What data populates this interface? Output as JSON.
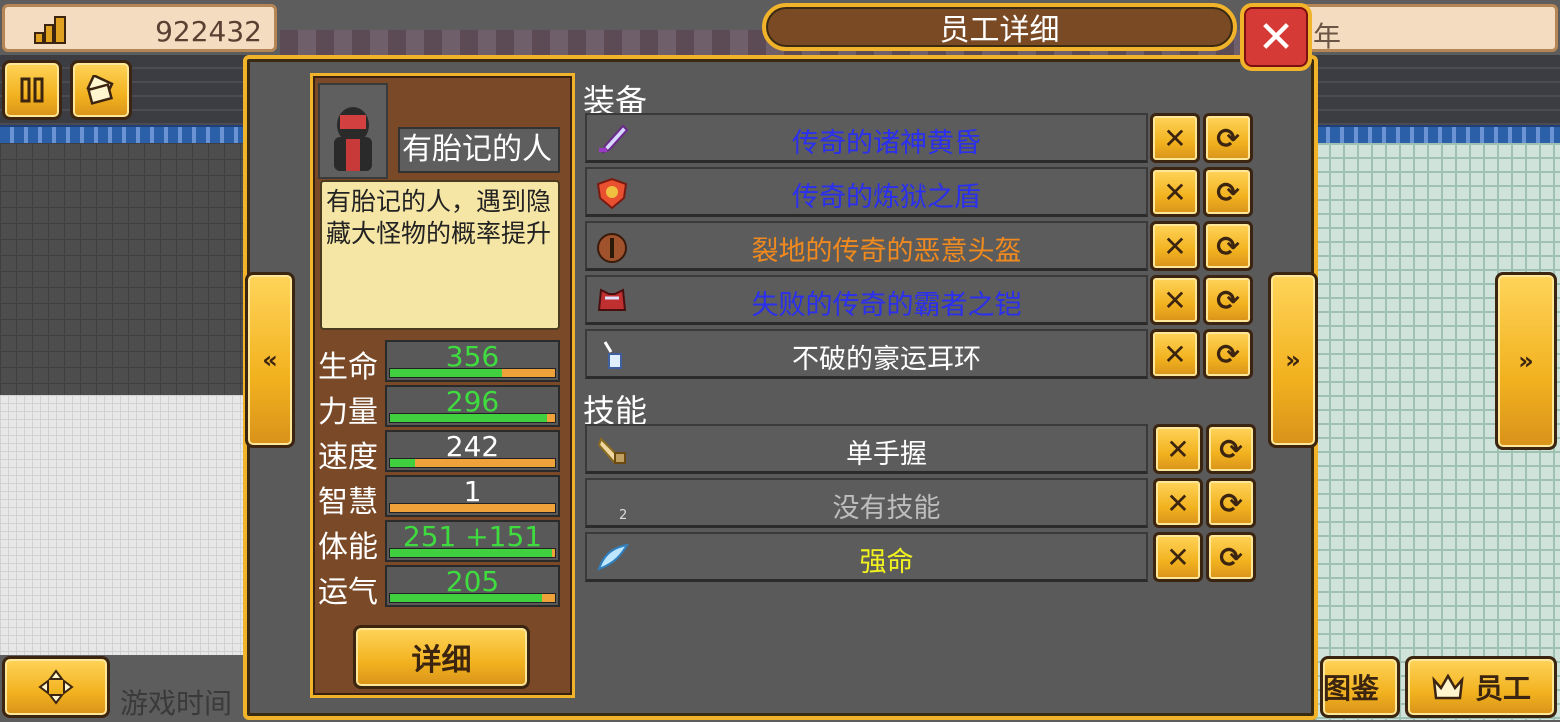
{
  "hud": {
    "money": "922432",
    "top_right_partial": "年",
    "game_time_label": "游戏时间",
    "book_label": "图鉴",
    "staff_label": "员工"
  },
  "dialog": {
    "title": "员工详细",
    "close_glyph": "✕",
    "prev_glyph": "«",
    "next_glyph": "»"
  },
  "character": {
    "name": "有胎记的人",
    "description": "有胎记的人，遇到隐藏大怪物的概率提升",
    "detail_label": "详细",
    "stats": [
      {
        "label": "生命",
        "value": "356",
        "color": "#3fdc3f",
        "fill": 0.68
      },
      {
        "label": "力量",
        "value": "296",
        "color": "#3fdc3f",
        "fill": 0.95
      },
      {
        "label": "速度",
        "value": "242",
        "color": "#ffffff",
        "fill": 0.15
      },
      {
        "label": "智慧",
        "value": "1",
        "color": "#ffffff",
        "fill": 0.0
      },
      {
        "label": "体能",
        "value": "251 +151",
        "color": "#3fdc3f",
        "fill": 0.98
      },
      {
        "label": "运气",
        "value": "205",
        "color": "#3fdc3f",
        "fill": 0.92
      }
    ]
  },
  "equipment": {
    "title": "装备",
    "items": [
      {
        "name": "传奇的诸神黄昏",
        "color": "#2a2ff0",
        "icon": "sword-icon"
      },
      {
        "name": "传奇的炼狱之盾",
        "color": "#2a2ff0",
        "icon": "shield-icon"
      },
      {
        "name": "裂地的传奇的恶意头盔",
        "color": "#f08a1e",
        "icon": "helmet-icon"
      },
      {
        "name": "失败的传奇的霸者之铠",
        "color": "#2a2ff0",
        "icon": "armor-icon"
      },
      {
        "name": "不破的豪运耳环",
        "color": "#ffffff",
        "icon": "earring-icon"
      }
    ]
  },
  "skills": {
    "title": "技能",
    "items": [
      {
        "name": "单手握",
        "color": "#ffffff",
        "icon": "hand-grip-icon",
        "slot": ""
      },
      {
        "name": "没有技能",
        "color": "#bdbdbd",
        "icon": "",
        "slot": "2"
      },
      {
        "name": "强命",
        "color": "#f2f21e",
        "icon": "wing-icon",
        "slot": ""
      }
    ]
  },
  "actions": {
    "remove_glyph": "✕",
    "swap_glyph": "⟳"
  }
}
